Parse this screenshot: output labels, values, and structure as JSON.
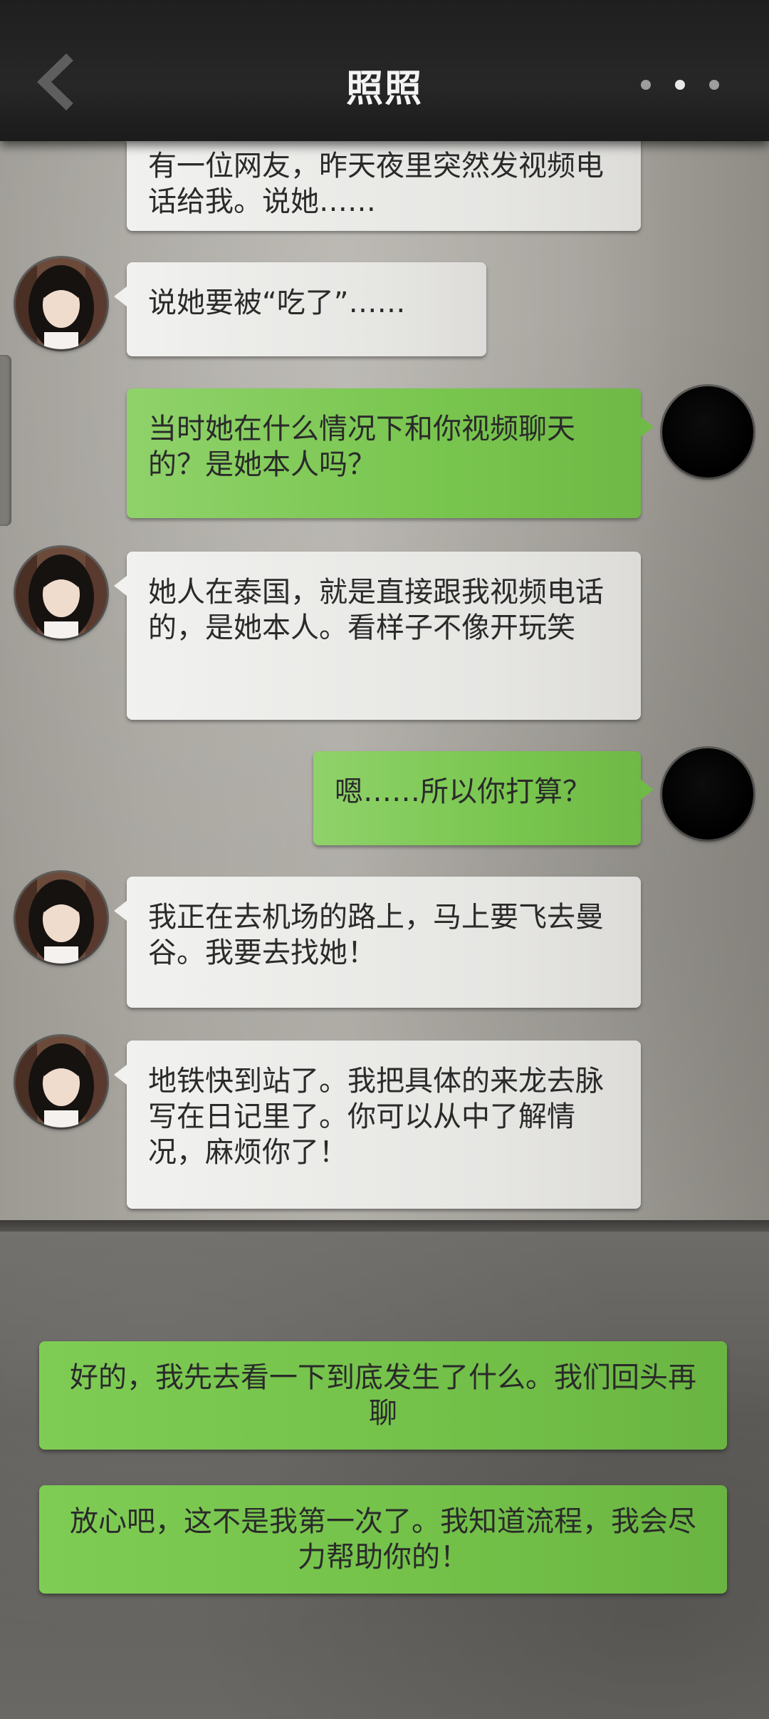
{
  "header": {
    "title": "照照",
    "back_icon": "chevron-left-icon",
    "more_icon": "more-dots-icon"
  },
  "messages": [
    {
      "sender": "contact",
      "text": "有一位网友，昨天夜里突然发视频电话给我。说她……"
    },
    {
      "sender": "contact",
      "text": "说她要被“吃了”……"
    },
    {
      "sender": "self",
      "text": "当时她在什么情况下和你视频聊天的？是她本人吗？"
    },
    {
      "sender": "contact",
      "text": "她人在泰国，就是直接跟我视频电话的，是她本人。看样子不像开玩笑"
    },
    {
      "sender": "self",
      "text": "嗯……所以你打算？"
    },
    {
      "sender": "contact",
      "text": "我正在去机场的路上，马上要飞去曼谷。我要去找她！"
    },
    {
      "sender": "contact",
      "text": "地铁快到站了。我把具体的来龙去脉写在日记里了。你可以从中了解情况，麻烦你了！"
    }
  ],
  "reply_options": [
    {
      "text": "好的，我先去看一下到底发生了什么。我们回头再聊"
    },
    {
      "text": "放心吧，这不是我第一次了。我知道流程，我会尽力帮助你的！"
    }
  ],
  "colors": {
    "header_bg": "#222222",
    "incoming_bubble": "#ececea",
    "outgoing_bubble": "#7cc852",
    "reply_option": "#76c34b"
  }
}
